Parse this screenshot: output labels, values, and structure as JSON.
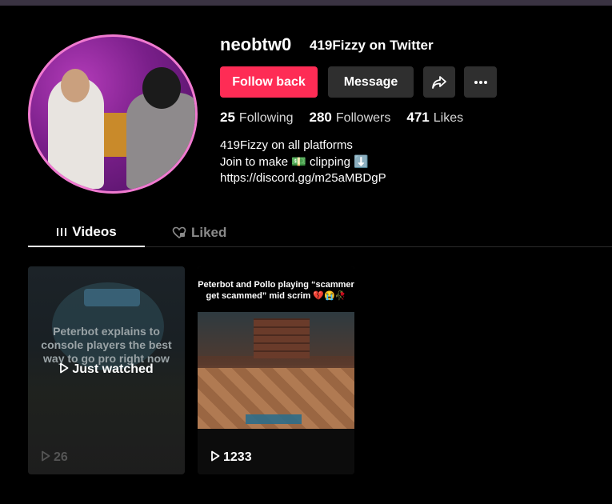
{
  "profile": {
    "username": "neobtw0",
    "nickname": "419Fizzy on Twitter",
    "avatar_icon": "profile-avatar"
  },
  "actions": {
    "follow_back": "Follow back",
    "message": "Message",
    "share_icon": "share-icon",
    "more_icon": "more-icon"
  },
  "stats": {
    "following_count": "25",
    "following_label": "Following",
    "followers_count": "280",
    "followers_label": "Followers",
    "likes_count": "471",
    "likes_label": "Likes"
  },
  "bio": {
    "line1": "419Fizzy on all platforms",
    "line2": "Join to make 💵 clipping ⬇️",
    "line3": "https://discord.gg/m25aMBDgP"
  },
  "tabs": {
    "videos": "Videos",
    "liked": "Liked"
  },
  "videos": [
    {
      "caption": "Peterbot explains to console players the best way to go pro right now",
      "status": "Just watched",
      "views": "26"
    },
    {
      "title": "Peterbot and Pollo playing “scammer get scammed” mid scrim 💔😭🥀",
      "views": "1233"
    }
  ],
  "colors": {
    "follow_button": "#fe2c55",
    "avatar_border": "#f07ad0",
    "secondary_button": "#2f2f2f"
  }
}
